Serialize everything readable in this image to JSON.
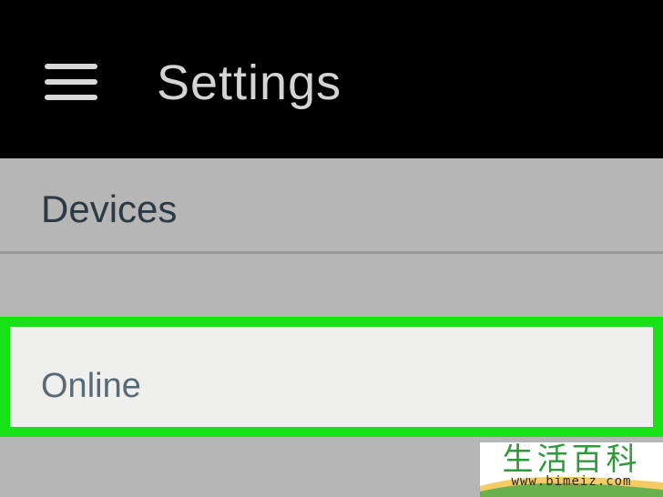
{
  "header": {
    "menu_icon": "hamburger-menu-icon",
    "title": "Settings"
  },
  "section": {
    "title": "Devices"
  },
  "items": [
    {
      "label": "Online",
      "highlighted": true
    }
  ],
  "watermark": {
    "text_cn": "生活百科",
    "url": "www.bimeiz.com"
  },
  "colors": {
    "app_bar": "#000000",
    "title_text": "#d4d4d4",
    "background": "#b6b6b6",
    "section_text": "#2c3a44",
    "item_background": "#efefed",
    "item_text": "#5a6a75",
    "highlight_border": "#16e316"
  }
}
